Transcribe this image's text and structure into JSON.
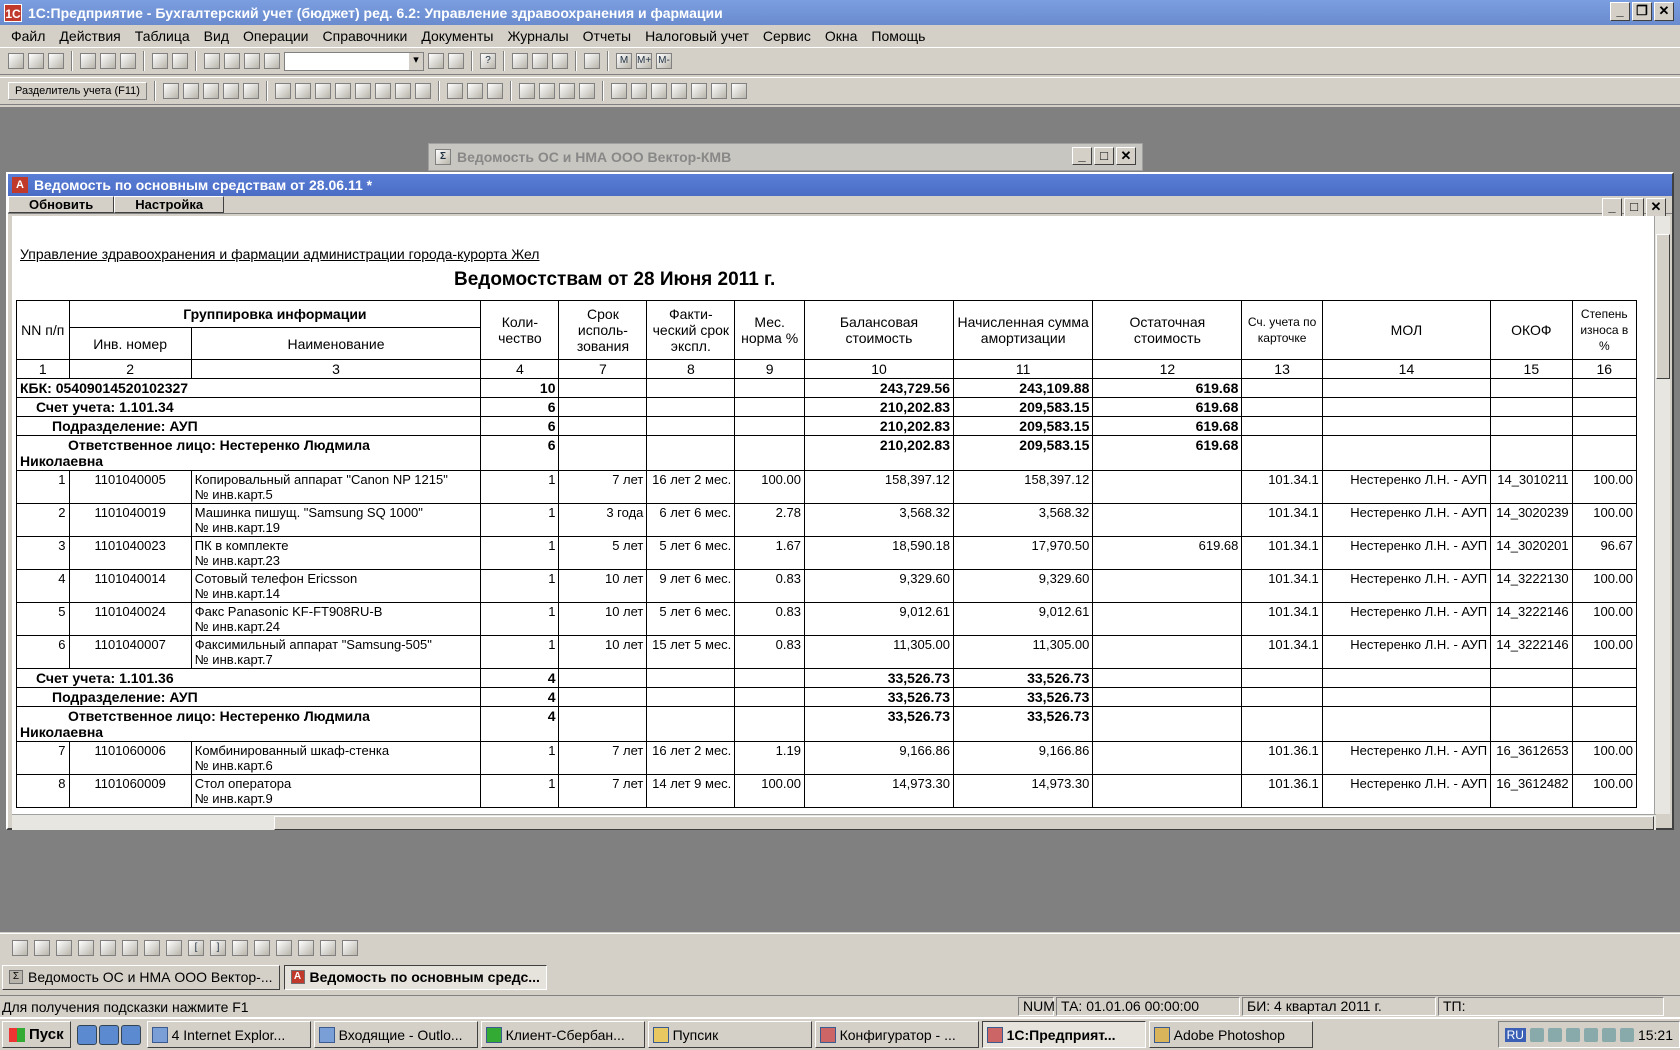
{
  "app": {
    "title": "1С:Предприятие - Бухгалтерский учет (бюджет) ред. 6.2:  Управление здравоохранения и фармации"
  },
  "menu": [
    "Файл",
    "Действия",
    "Таблица",
    "Вид",
    "Операции",
    "Справочники",
    "Документы",
    "Журналы",
    "Отчеты",
    "Налоговый учет",
    "Сервис",
    "Окна",
    "Помощь"
  ],
  "toolbar2": {
    "separator_label": "Разделитель учета (F11)"
  },
  "bg_window": {
    "title": "Ведомость ОС и НМА ООО Вектор-КМВ"
  },
  "main_window": {
    "title": "Ведомость по основным средствам от 28.06.11  *",
    "refresh_label": "Обновить",
    "settings_label": "Настройка",
    "org_line": "Управление здравоохранения и фармации администрации города-курорта Жел",
    "report_title": "Ведомостствам от 28 Июня 2011 г."
  },
  "table": {
    "headers": {
      "nn": "NN п/п",
      "group": "Группировка  информации",
      "inv": "Инв. номер",
      "name": "Наименование",
      "qty": "Коли- чество",
      "term": "Срок исполь- зования",
      "fact": "Факти- ческий срок экспл.",
      "rate": "Мес. норма %",
      "bal": "Балансовая стоимость",
      "amort": "Начисленная сумма амортизации",
      "rest": "Остаточная стоимость",
      "acc": "Сч. учета по карточке",
      "mol": "МОЛ",
      "okof": "ОКОФ",
      "wear": "Степень износа в %"
    },
    "col_numbers": [
      "1",
      "2",
      "3",
      "4",
      "7",
      "8",
      "9",
      "10",
      "11",
      "12",
      "13",
      "14",
      "15",
      "16"
    ],
    "rows": [
      {
        "type": "group",
        "label": "КБК: 05409014520102327",
        "qty": "10",
        "bal": "243,729.56",
        "amort": "243,109.88",
        "rest": "619.68",
        "indent": 0
      },
      {
        "type": "group",
        "label": "Счет учета: 1.101.34",
        "qty": "6",
        "bal": "210,202.83",
        "amort": "209,583.15",
        "rest": "619.68",
        "indent": 1
      },
      {
        "type": "group",
        "label": "Подразделение: АУП",
        "qty": "6",
        "bal": "210,202.83",
        "amort": "209,583.15",
        "rest": "619.68",
        "indent": 2
      },
      {
        "type": "group2",
        "label1": "Ответственное лицо: Нестеренко Людмила",
        "label2": "Николаевна",
        "qty": "6",
        "bal": "210,202.83",
        "amort": "209,583.15",
        "rest": "619.68"
      },
      {
        "type": "item",
        "nn": "1",
        "inv": "1101040005",
        "name1": "Копировальный аппарат \"Canon NP 1215\"",
        "name2": "№ инв.карт.5",
        "qty": "1",
        "term": "7 лет",
        "fact": "16 лет 2 мес.",
        "rate": "100.00",
        "bal": "158,397.12",
        "amort": "158,397.12",
        "rest": "",
        "acc": "101.34.1",
        "mol": "Нестеренко Л.Н. - АУП",
        "okof": "14_3010211",
        "wear": "100.00"
      },
      {
        "type": "item",
        "nn": "2",
        "inv": "1101040019",
        "name1": "Машинка пишущ. \"Samsung SQ 1000\"",
        "name2": "№ инв.карт.19",
        "qty": "1",
        "term": "3 года",
        "fact": "6 лет 6 мес.",
        "rate": "2.78",
        "bal": "3,568.32",
        "amort": "3,568.32",
        "rest": "",
        "acc": "101.34.1",
        "mol": "Нестеренко Л.Н. - АУП",
        "okof": "14_3020239",
        "wear": "100.00"
      },
      {
        "type": "item",
        "nn": "3",
        "inv": "1101040023",
        "name1": "ПК в комплекте",
        "name2": "№ инв.карт.23",
        "qty": "1",
        "term": "5 лет",
        "fact": "5 лет 6 мес.",
        "rate": "1.67",
        "bal": "18,590.18",
        "amort": "17,970.50",
        "rest": "619.68",
        "acc": "101.34.1",
        "mol": "Нестеренко Л.Н. - АУП",
        "okof": "14_3020201",
        "wear": "96.67"
      },
      {
        "type": "item",
        "nn": "4",
        "inv": "1101040014",
        "name1": "Сотовый телефон Ericsson",
        "name2": "№ инв.карт.14",
        "qty": "1",
        "term": "10 лет",
        "fact": "9 лет 6 мес.",
        "rate": "0.83",
        "bal": "9,329.60",
        "amort": "9,329.60",
        "rest": "",
        "acc": "101.34.1",
        "mol": "Нестеренко Л.Н. - АУП",
        "okof": "14_3222130",
        "wear": "100.00"
      },
      {
        "type": "item",
        "nn": "5",
        "inv": "1101040024",
        "name1": "Факс Panasonic KF-FT908RU-B",
        "name2": "№ инв.карт.24",
        "qty": "1",
        "term": "10 лет",
        "fact": "5 лет 6 мес.",
        "rate": "0.83",
        "bal": "9,012.61",
        "amort": "9,012.61",
        "rest": "",
        "acc": "101.34.1",
        "mol": "Нестеренко Л.Н. - АУП",
        "okof": "14_3222146",
        "wear": "100.00"
      },
      {
        "type": "item",
        "nn": "6",
        "inv": "1101040007",
        "name1": "Факсимильный аппарат \"Samsung-505\"",
        "name2": "№ инв.карт.7",
        "qty": "1",
        "term": "10 лет",
        "fact": "15 лет 5 мес.",
        "rate": "0.83",
        "bal": "11,305.00",
        "amort": "11,305.00",
        "rest": "",
        "acc": "101.34.1",
        "mol": "Нестеренко Л.Н. - АУП",
        "okof": "14_3222146",
        "wear": "100.00"
      },
      {
        "type": "group",
        "label": "Счет учета: 1.101.36",
        "qty": "4",
        "bal": "33,526.73",
        "amort": "33,526.73",
        "rest": "",
        "indent": 1
      },
      {
        "type": "group",
        "label": "Подразделение: АУП",
        "qty": "4",
        "bal": "33,526.73",
        "amort": "33,526.73",
        "rest": "",
        "indent": 2
      },
      {
        "type": "group2",
        "label1": "Ответственное лицо: Нестеренко Людмила",
        "label2": "Николаевна",
        "qty": "4",
        "bal": "33,526.73",
        "amort": "33,526.73",
        "rest": ""
      },
      {
        "type": "item",
        "nn": "7",
        "inv": "1101060006",
        "name1": "Комбинированный шкаф-стенка",
        "name2": "№ инв.карт.6",
        "qty": "1",
        "term": "7 лет",
        "fact": "16 лет 2 мес.",
        "rate": "1.19",
        "bal": "9,166.86",
        "amort": "9,166.86",
        "rest": "",
        "acc": "101.36.1",
        "mol": "Нестеренко Л.Н. - АУП",
        "okof": "16_3612653",
        "wear": "100.00"
      },
      {
        "type": "item",
        "nn": "8",
        "inv": "1101060009",
        "name1": "Стол оператора",
        "name2": "№ инв.карт.9",
        "qty": "1",
        "term": "7 лет",
        "fact": "14 лет 9 мес.",
        "rate": "100.00",
        "bal": "14,973.30",
        "amort": "14,973.30",
        "rest": "",
        "acc": "101.36.1",
        "mol": "Нестеренко Л.Н. - АУП",
        "okof": "16_3612482",
        "wear": "100.00"
      }
    ]
  },
  "mdi_tabs": [
    "Ведомость ОС и НМА ООО Вектор-...",
    "Ведомость по основным средс..."
  ],
  "status": {
    "hint": "Для получения подсказки нажмите F1",
    "num": "NUM",
    "ta": "ТА: 01.01.06  00:00:00",
    "bi": "БИ: 4 квартал 2011 г.",
    "tp": "ТП:"
  },
  "taskbar": {
    "start": "Пуск",
    "tasks": [
      "4 Internet Explor...",
      "Входящие - Outlo...",
      "Клиент-Сбербан...",
      "Пупсик",
      "Конфигуратор - ...",
      "1С:Предприят...",
      "Adobe Photoshop"
    ],
    "lang": "RU",
    "clock": "15:21"
  }
}
